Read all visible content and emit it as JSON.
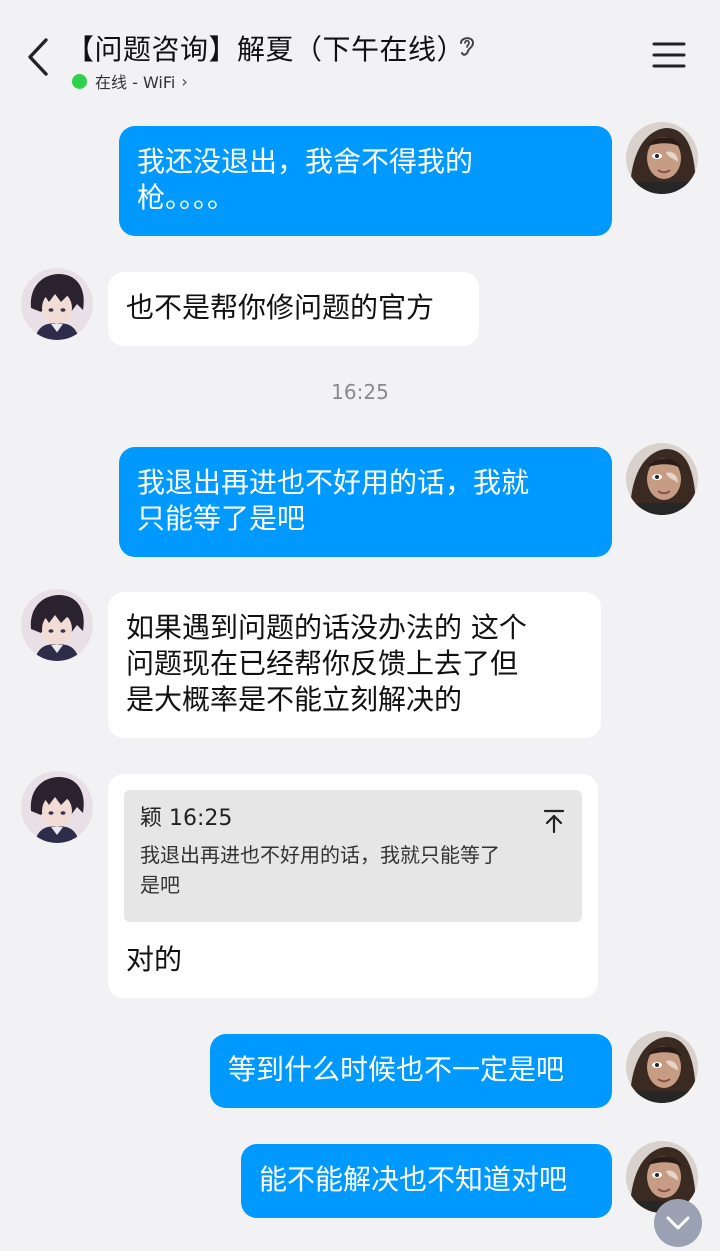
{
  "header": {
    "title": "【问题咨询】解夏（下午在线）",
    "status_text": "在线 - WiFi",
    "status_chevron": "›",
    "status_color": "#2fd14c"
  },
  "icons": {
    "back": "chevron-left-icon",
    "ear": "ear-icon",
    "menu": "menu-icon",
    "quote_jump": "arrow-up-bar-icon",
    "scroll_down": "chevron-down-icon"
  },
  "colors": {
    "my_bubble": "#0099ff",
    "their_bubble": "#ffffff",
    "background": "#f2f2f4"
  },
  "messages": [
    {
      "from": "me",
      "text": "我还没退出，我舍不得我的\n枪。。。。"
    },
    {
      "from": "them",
      "text": "也不是帮你修问题的官方"
    },
    {
      "type": "time",
      "text": "16:25"
    },
    {
      "from": "me",
      "text": "我退出再进也不好用的话，我就\n只能等了是吧"
    },
    {
      "from": "them",
      "text": "如果遇到问题的话没办法的 这个\n问题现在已经帮你反馈上去了但\n是大概率是不能立刻解决的"
    },
    {
      "from": "them",
      "quote": {
        "sender": "颖",
        "time": "16:25",
        "text": "我退出再进也不好用的话，我就只能等了\n是吧"
      },
      "text": "对的"
    },
    {
      "from": "me",
      "text": "等到什么时候也不一定是吧"
    },
    {
      "from": "me",
      "text": "能不能解决也不知道对吧"
    }
  ]
}
